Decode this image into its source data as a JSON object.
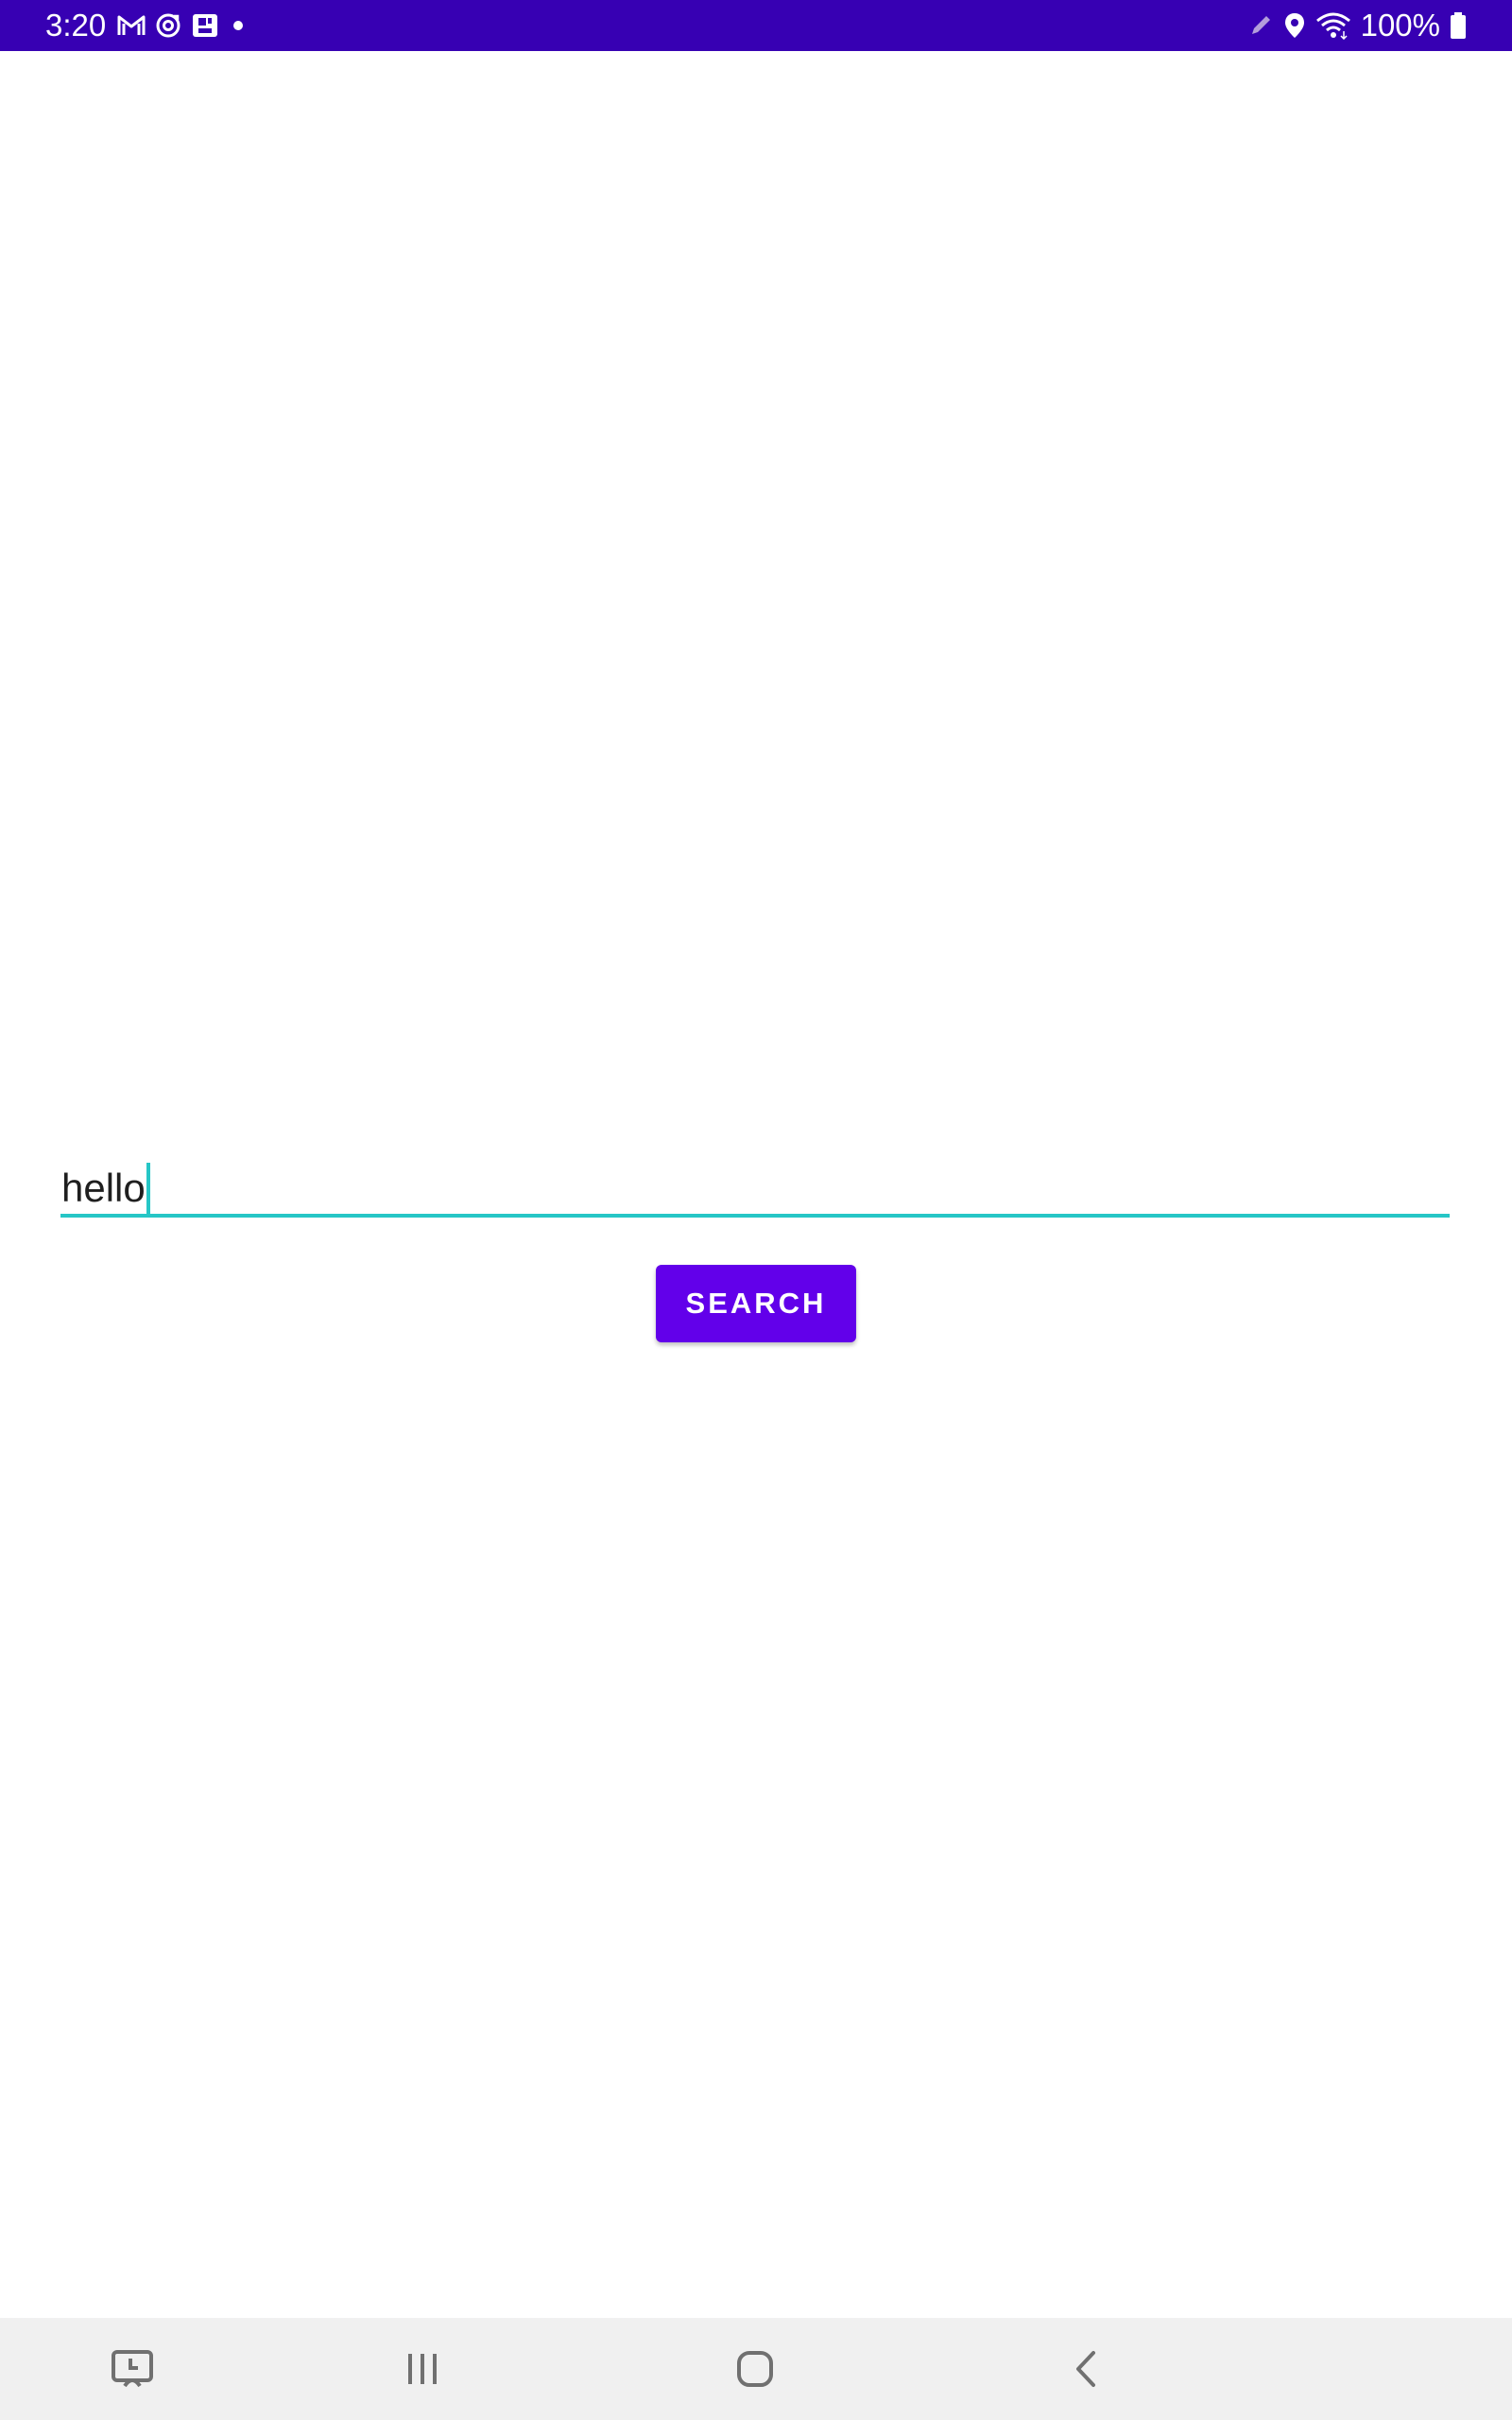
{
  "status_bar": {
    "time": "3:20",
    "battery_text": "100%",
    "background_color": "#3700b3",
    "left_icons": [
      "gmail-icon",
      "sync-icon",
      "photo-icon",
      "dot-icon"
    ],
    "right_icons": [
      "pen-icon",
      "location-icon",
      "wifi-icon",
      "battery-icon"
    ]
  },
  "search": {
    "value": "hello",
    "underline_color": "#26c6c6"
  },
  "search_button": {
    "label": "SEARCH",
    "color": "#6200ea"
  },
  "nav_bar": {
    "items": [
      "screenshot-icon",
      "recent-apps-icon",
      "home-icon",
      "back-icon"
    ]
  }
}
